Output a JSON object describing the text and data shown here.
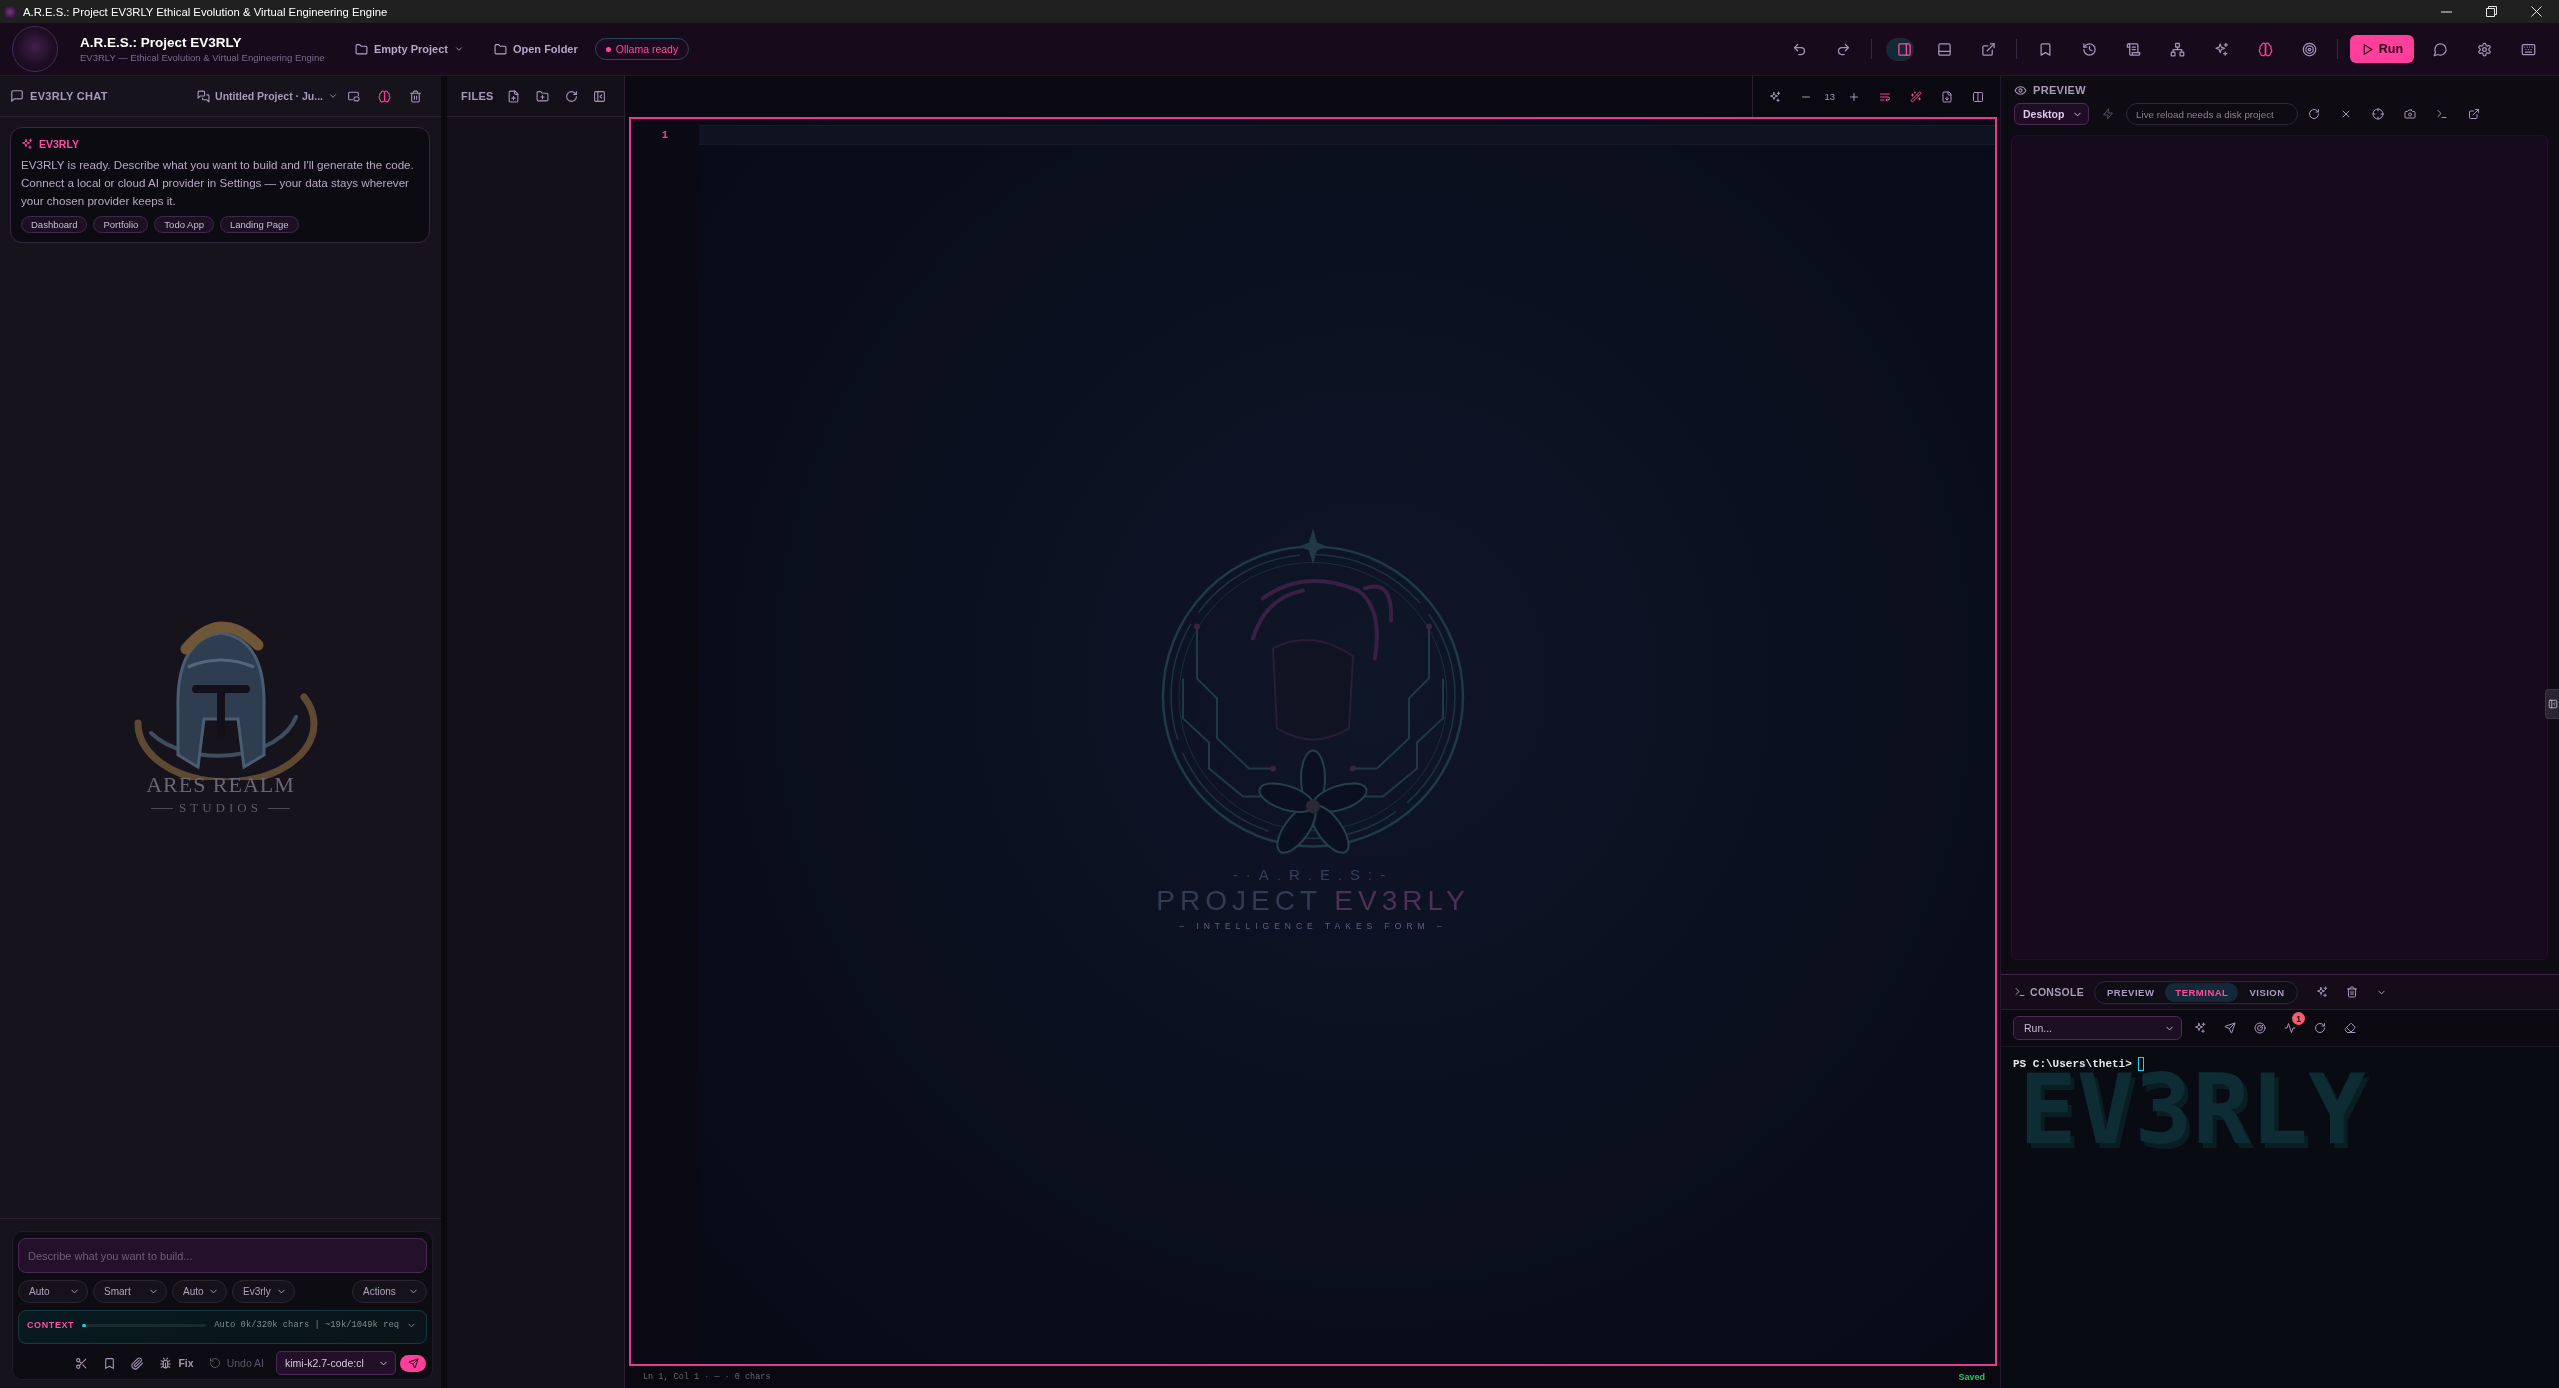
{
  "window": {
    "title": "A.R.E.S.: Project EV3RLY Ethical Evolution & Virtual Engineering Engine"
  },
  "app_bar": {
    "title": "A.R.E.S.: Project EV3RLY",
    "subtitle": "EV3RLY — Ethical Evolution & Virtual Engineering Engine",
    "project": "Empty Project",
    "open_folder": "Open Folder",
    "status": "Ollama ready",
    "layout_toggles": [
      {
        "selected": true
      },
      {
        "selected": false
      }
    ],
    "brain_on": true,
    "run": "Run"
  },
  "chat": {
    "title": "EV3RLY CHAT",
    "session": "Untitled Project · Ju...",
    "brain_on": true,
    "message": {
      "author": "EV3RLY",
      "text": "EV3RLY is ready. Describe what you want to build and I'll generate the code. Connect a local or cloud AI provider in Settings — your data stays wherever your chosen provider keeps it.",
      "suggestions": [
        "Dashboard",
        "Portfolio",
        "Todo App",
        "Landing Page"
      ]
    },
    "logo": {
      "name": "ARES REALM",
      "tagline": "STUDIOS"
    },
    "composer": {
      "placeholder": "Describe what you want to build...",
      "selects": [
        "Auto",
        "Smart",
        "Auto",
        "Ev3rly"
      ],
      "actions": "Actions",
      "context": {
        "label": "CONTEXT",
        "level": 0.03,
        "summary": "Auto 0k/320k chars | ~19k/1049k req"
      },
      "fix": "Fix",
      "undo": {
        "label": "Undo AI",
        "disabled": true
      },
      "model": "kimi-k2.7-code:cl"
    }
  },
  "files": {
    "title": "FILES"
  },
  "editor": {
    "font_size": "13",
    "wrap_on": true,
    "wand_on": true,
    "lines": [
      {
        "number": "1",
        "current": true
      }
    ],
    "emblem": {
      "mark": "-·A.R.E.S:-",
      "title": "PROJECT",
      "accent": "EV3RLY",
      "tagline": "– INTELLIGENCE TAKES FORM –"
    },
    "status": "Ln 1, Col 1 · — · 0 chars",
    "saved": "Saved"
  },
  "preview": {
    "title": "PREVIEW",
    "device": "Desktop",
    "placeholder": "Live reload needs a disk project"
  },
  "console": {
    "title": "CONSOLE",
    "tabs": [
      {
        "label": "PREVIEW",
        "selected": false
      },
      {
        "label": "TERMINAL",
        "selected": true
      },
      {
        "label": "VISION",
        "selected": false
      }
    ],
    "command": "Run...",
    "alerts": "1",
    "prompt": "PS C:\\Users\\theti>",
    "banner": "EV3RLY"
  }
}
